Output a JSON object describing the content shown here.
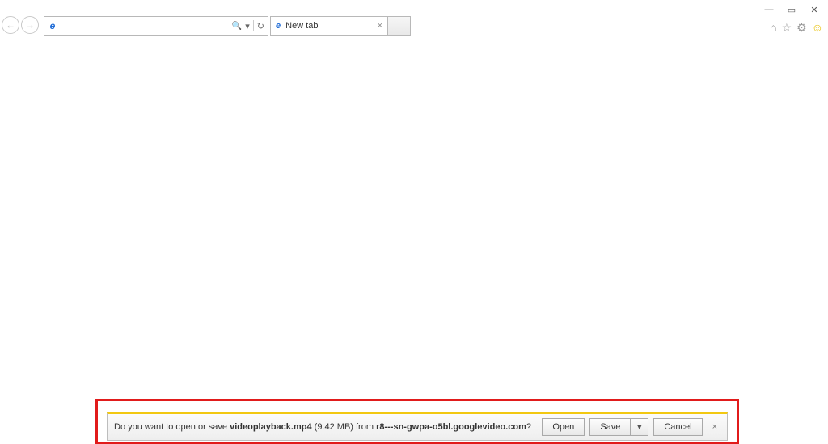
{
  "window_controls": {
    "minimize_glyph": "—",
    "maximize_glyph": "▭",
    "close_glyph": "✕"
  },
  "nav": {
    "back_glyph": "←",
    "forward_glyph": "→"
  },
  "address_bar": {
    "favicon_glyph": "e",
    "value": "",
    "search_glyph": "🔍",
    "dropdown_glyph": "▾",
    "refresh_glyph": "↻"
  },
  "tab": {
    "icon_glyph": "e",
    "title": "New tab",
    "close_glyph": "×"
  },
  "right_icons": {
    "home_glyph": "⌂",
    "favorites_glyph": "☆",
    "tools_glyph": "⚙",
    "smiley_glyph": "☺"
  },
  "download_bar": {
    "question_prefix": "Do you want to open or save ",
    "filename": "videoplayback.mp4",
    "size_text": " (9.42 MB) ",
    "from_text": "from ",
    "host": "r8---sn-gwpa-o5bl.googlevideo.com",
    "question_suffix": "?",
    "open_label": "Open",
    "save_label": "Save",
    "save_caret": "▼",
    "cancel_label": "Cancel",
    "close_glyph": "×"
  }
}
